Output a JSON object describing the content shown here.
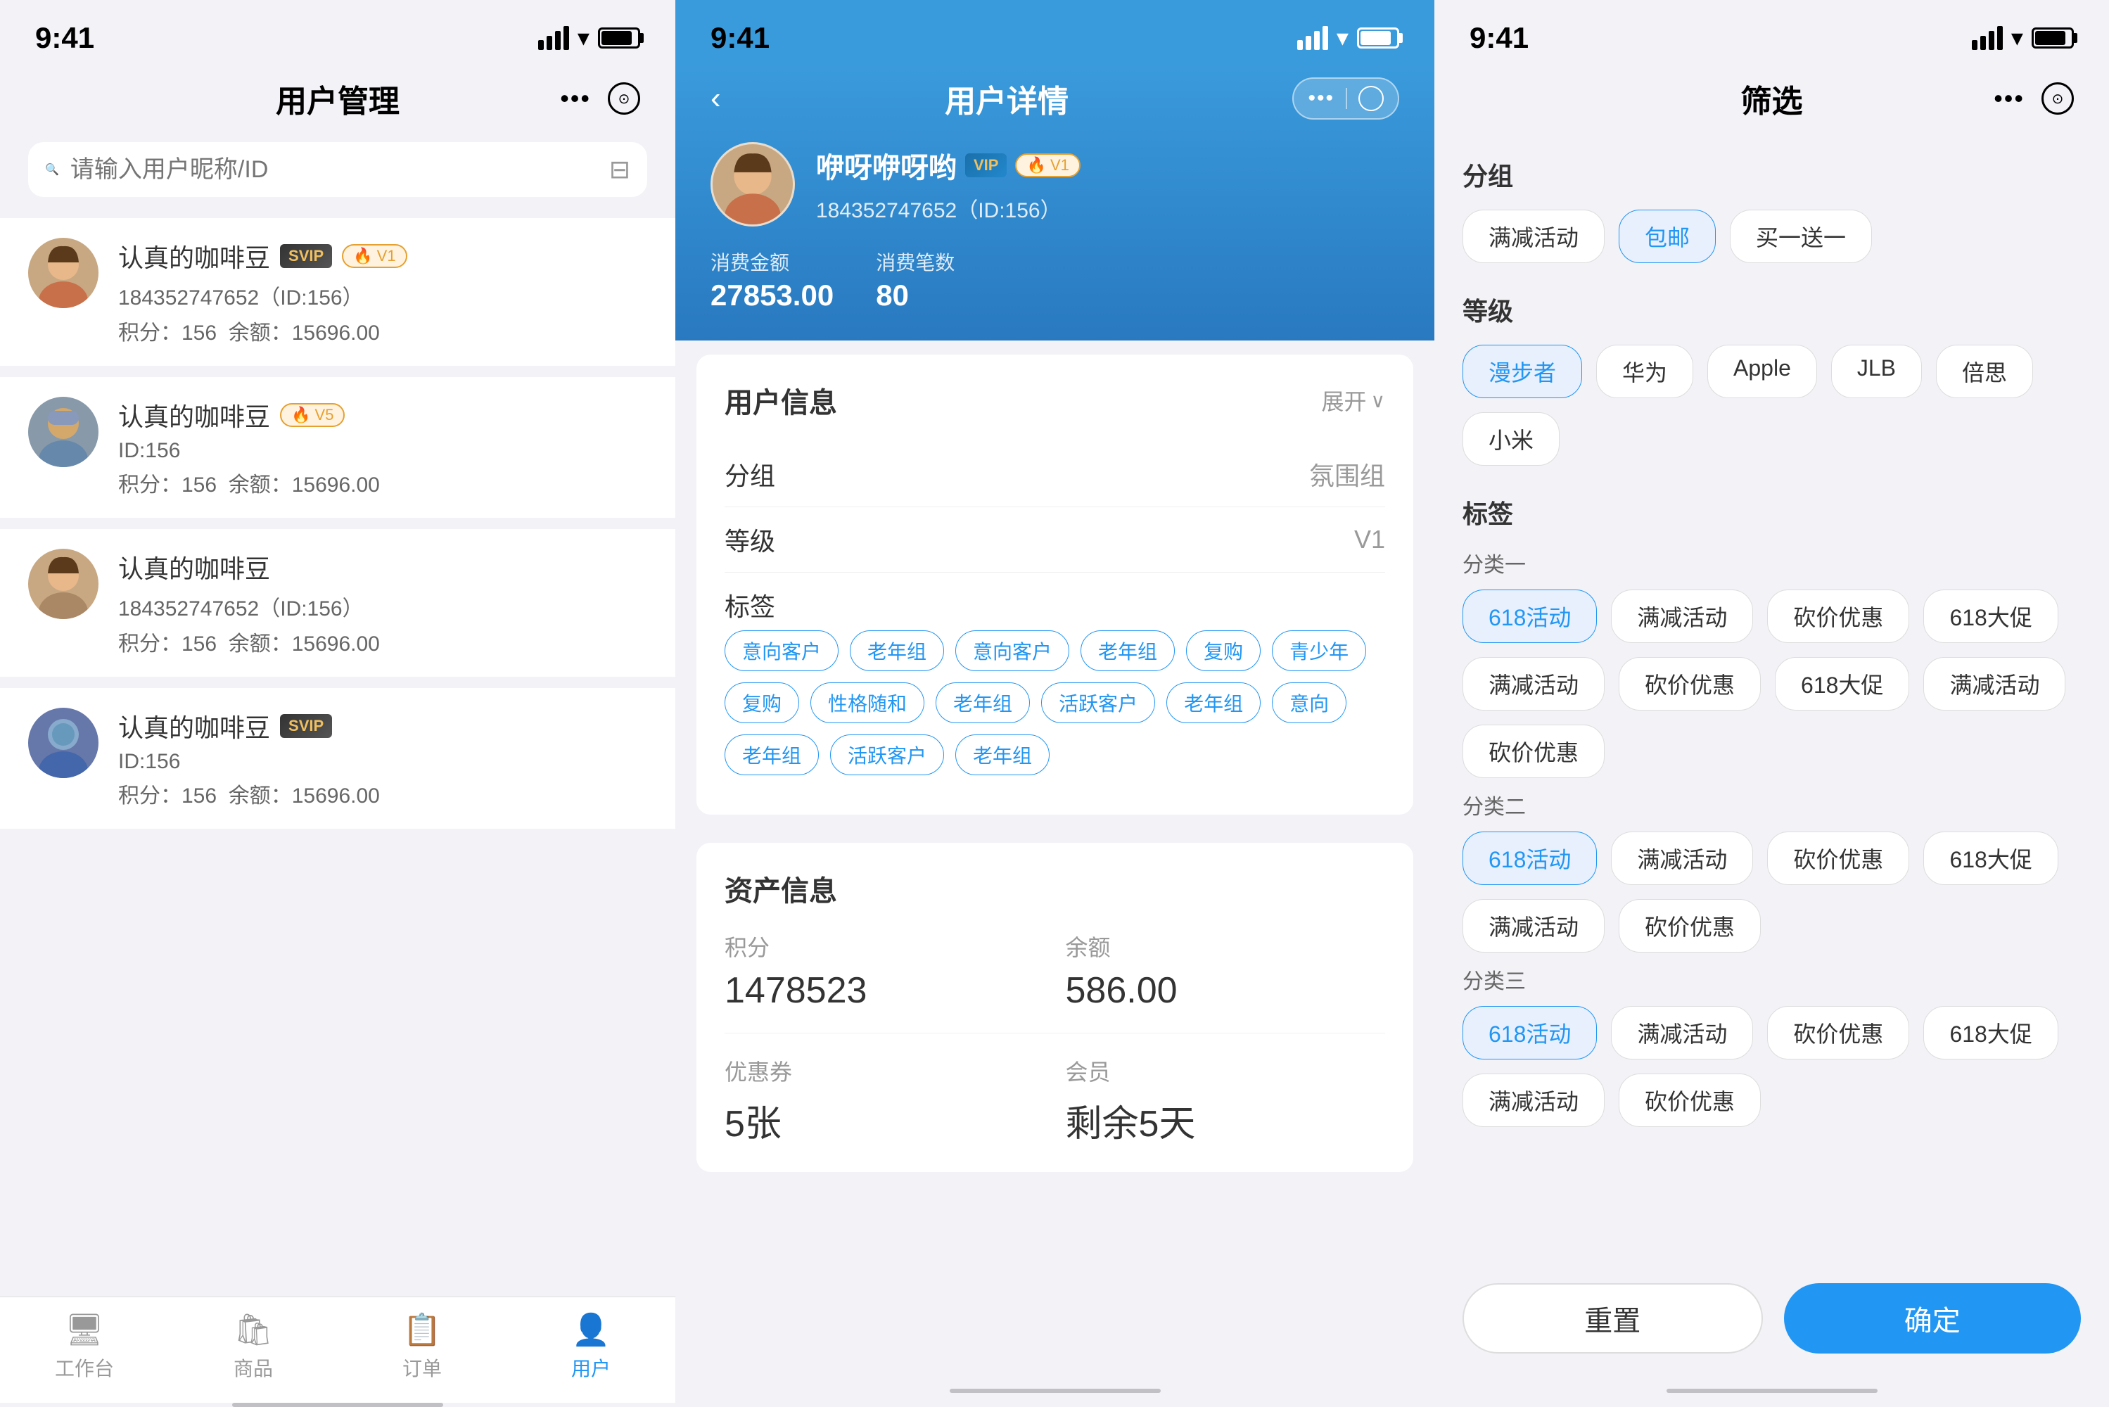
{
  "panel1": {
    "status": {
      "time": "9:41"
    },
    "title": "用户管理",
    "search_placeholder": "请输入用户昵称/ID",
    "users": [
      {
        "name": "认真的咖啡豆",
        "badges": [
          "SVIP",
          "V1"
        ],
        "id_text": "184352747652（ID:156）",
        "points": "积分：156",
        "balance": "余额：15696.00",
        "avatar_type": "female1"
      },
      {
        "name": "认真的咖啡豆",
        "badges": [
          "V5"
        ],
        "id_text": "ID:156",
        "points": "积分：156",
        "balance": "余额：15696.00",
        "avatar_type": "male1"
      },
      {
        "name": "认真的咖啡豆",
        "badges": [],
        "id_text": "184352747652（ID:156）",
        "points": "积分：156",
        "balance": "余额：15696.00",
        "avatar_type": "female2"
      },
      {
        "name": "认真的咖啡豆",
        "badges": [
          "SVIP"
        ],
        "id_text": "ID:156",
        "points": "积分：156",
        "balance": "余额：15696.00",
        "avatar_type": "male2"
      }
    ],
    "tabs": [
      {
        "label": "工作台",
        "icon": "🖥",
        "active": false
      },
      {
        "label": "商品",
        "icon": "🛍",
        "active": false
      },
      {
        "label": "订单",
        "icon": "📋",
        "active": false
      },
      {
        "label": "用户",
        "icon": "👤",
        "active": true
      }
    ]
  },
  "panel2": {
    "status": {
      "time": "9:41"
    },
    "back_label": "‹",
    "title": "用户详情",
    "profile": {
      "name": "咿呀咿呀哟",
      "id_text": "184352747652（ID:156）",
      "badges": [
        "VIP",
        "V1"
      ]
    },
    "stats": [
      {
        "label": "消费金额",
        "value": "27853.00"
      },
      {
        "label": "消费笔数",
        "value": "80"
      }
    ],
    "user_info": {
      "title": "用户信息",
      "expand_label": "展开",
      "rows": [
        {
          "label": "分组",
          "value": "氛围组"
        },
        {
          "label": "等级",
          "value": "V1"
        }
      ],
      "tags_label": "标签",
      "tags": [
        "意向客户",
        "老年组",
        "意向客户",
        "老年组",
        "复购",
        "青少年",
        "复购",
        "性格随和",
        "老年组",
        "活跃客户",
        "老年组",
        "意向",
        "老年组",
        "活跃客户",
        "老年组"
      ]
    },
    "assets": {
      "title": "资产信息",
      "items": [
        {
          "label": "积分",
          "value": "1478523"
        },
        {
          "label": "余额",
          "value": "586.00"
        },
        {
          "label": "优惠券",
          "value": "5张"
        },
        {
          "label": "会员",
          "value": "剩余5天"
        }
      ]
    }
  },
  "panel3": {
    "status": {
      "time": "9:41"
    },
    "title": "筛选",
    "sections": [
      {
        "title": "分组",
        "subsections": [
          {
            "subtitle": "",
            "chips": [
              {
                "label": "满减活动",
                "active": false
              },
              {
                "label": "包邮",
                "active": true
              },
              {
                "label": "买一送一",
                "active": false
              }
            ]
          }
        ]
      },
      {
        "title": "等级",
        "subsections": [
          {
            "subtitle": "",
            "chips": [
              {
                "label": "漫步者",
                "active": true
              },
              {
                "label": "华为",
                "active": false
              },
              {
                "label": "Apple",
                "active": false
              },
              {
                "label": "JLB",
                "active": false
              },
              {
                "label": "倍思",
                "active": false
              },
              {
                "label": "小米",
                "active": false
              }
            ]
          }
        ]
      },
      {
        "title": "标签",
        "subsections": [
          {
            "subtitle": "分类一",
            "chips": [
              {
                "label": "618活动",
                "active": true
              },
              {
                "label": "满减活动",
                "active": false
              },
              {
                "label": "砍价优惠",
                "active": false
              },
              {
                "label": "618大促",
                "active": false
              },
              {
                "label": "满减活动",
                "active": false
              },
              {
                "label": "砍价优惠",
                "active": false
              },
              {
                "label": "618大促",
                "active": false
              },
              {
                "label": "满减活动",
                "active": false
              },
              {
                "label": "砍价优惠",
                "active": false
              }
            ]
          },
          {
            "subtitle": "分类二",
            "chips": [
              {
                "label": "618活动",
                "active": true
              },
              {
                "label": "满减活动",
                "active": false
              },
              {
                "label": "砍价优惠",
                "active": false
              },
              {
                "label": "618大促",
                "active": false
              },
              {
                "label": "满减活动",
                "active": false
              },
              {
                "label": "砍价优惠",
                "active": false
              }
            ]
          },
          {
            "subtitle": "分类三",
            "chips": [
              {
                "label": "618活动",
                "active": true
              },
              {
                "label": "满减活动",
                "active": false
              },
              {
                "label": "砍价优惠",
                "active": false
              },
              {
                "label": "618大促",
                "active": false
              },
              {
                "label": "满减活动",
                "active": false
              },
              {
                "label": "砍价优惠",
                "active": false
              }
            ]
          }
        ]
      }
    ],
    "buttons": {
      "reset": "重置",
      "confirm": "确定"
    }
  }
}
